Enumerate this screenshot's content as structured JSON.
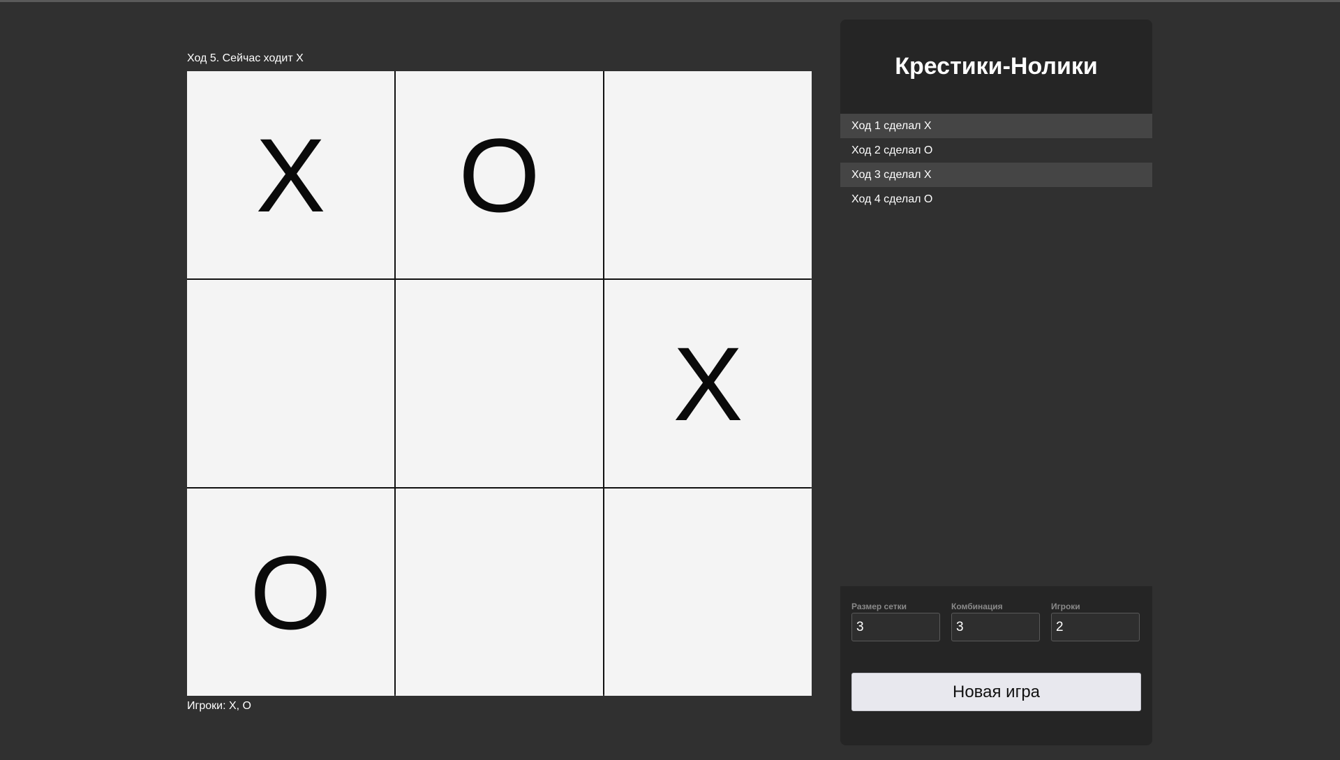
{
  "status_text": "Ход 5. Сейчас ходит X",
  "board": {
    "cells": [
      "X",
      "O",
      "",
      "",
      "",
      "X",
      "O",
      "",
      ""
    ]
  },
  "players_text": "Игроки: X, O",
  "panel": {
    "title": "Крестики-Нолики",
    "history": [
      "Ход 1 сделал X",
      "Ход 2 сделал O",
      "Ход 3 сделал X",
      "Ход 4 сделал O"
    ]
  },
  "settings": {
    "grid_size_label": "Размер сетки",
    "grid_size_value": "3",
    "combination_label": "Комбинация",
    "combination_value": "3",
    "players_label": "Игроки",
    "players_value": "2"
  },
  "new_game_label": "Новая игра",
  "colors": {
    "background": "#303030",
    "panel": "#252525",
    "cell": "#f4f4f4",
    "history_highlight": "#454545",
    "button": "#e8e8ee"
  }
}
